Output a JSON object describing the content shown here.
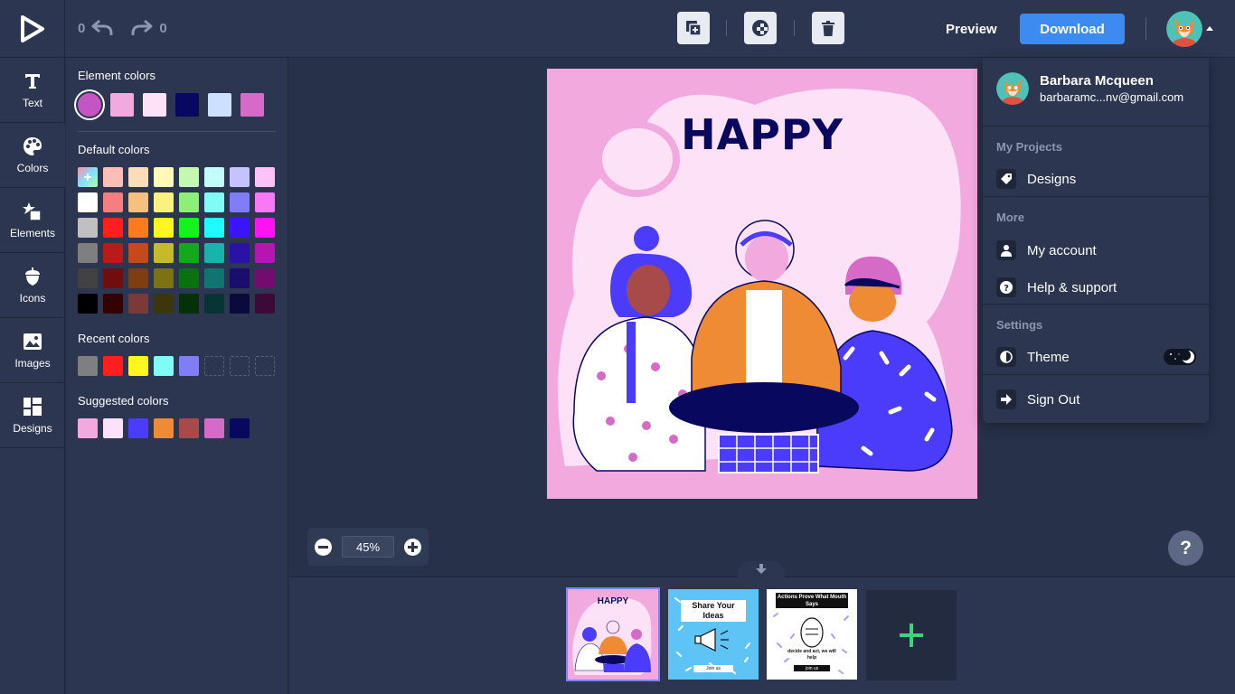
{
  "toolbar": {
    "undo_count": "0",
    "redo_count": "0",
    "preview_label": "Preview",
    "download_label": "Download"
  },
  "rail": {
    "items": [
      {
        "label": "Text",
        "icon": "text-icon"
      },
      {
        "label": "Colors",
        "icon": "palette-icon"
      },
      {
        "label": "Elements",
        "icon": "elements-icon"
      },
      {
        "label": "Icons",
        "icon": "acorn-icon"
      },
      {
        "label": "Images",
        "icon": "image-icon"
      },
      {
        "label": "Designs",
        "icon": "grid-icon"
      }
    ]
  },
  "panel": {
    "element_colors_title": "Element colors",
    "element_colors": [
      "#c356c4",
      "#f2a9de",
      "#fde1f6",
      "#08085e",
      "#cde0ff",
      "#d56bc6"
    ],
    "default_colors_title": "Default colors",
    "default_colors": [
      [
        "add",
        "#ffbdb8",
        "#ffdcb8",
        "#fffab8",
        "#c4f7b0",
        "#c2fffc",
        "#c4c2ff",
        "#ffc2f6"
      ],
      [
        "#ffffff",
        "#f57e7e",
        "#f8c07f",
        "#faf27e",
        "#8cf076",
        "#7ffcf8",
        "#7f7ef7",
        "#f979f5"
      ],
      [
        "#c0c0c0",
        "#ff1f1f",
        "#ff7a1f",
        "#fff51f",
        "#16f21e",
        "#1ffcff",
        "#3a14ff",
        "#ff14f1"
      ],
      [
        "#7f7f7f",
        "#bb1a1a",
        "#c74819",
        "#c7ba28",
        "#12a91d",
        "#17b3ac",
        "#2a11a8",
        "#b714b0"
      ],
      [
        "#424242",
        "#720d0d",
        "#7f3d11",
        "#7b7214",
        "#09720e",
        "#107470",
        "#190d6e",
        "#720c70"
      ],
      [
        "#000000",
        "#330203",
        "#7a3a3a",
        "#3b360b",
        "#053108",
        "#063534",
        "#0b0a3d",
        "#3b0a35"
      ]
    ],
    "recent_colors_title": "Recent colors",
    "recent_colors": [
      "#7f7f7f",
      "#ff1f1f",
      "#fff51f",
      "#7ffcf8",
      "#7f7ef7",
      "",
      "",
      ""
    ],
    "suggested_colors_title": "Suggested colors",
    "suggested_colors": [
      "#f2a9de",
      "#fde1f6",
      "#4a3cfa",
      "#f08b35",
      "#a94a4a",
      "#d56bc6",
      "#08085e"
    ]
  },
  "artboard": {
    "title": "HAPPY",
    "background": "#f2a9de"
  },
  "zoom": {
    "value": "45%"
  },
  "pages": {
    "thumbs": [
      {
        "title": "HAPPY"
      },
      {
        "title": "Share Your Ideas",
        "button": "Join us"
      },
      {
        "title": "Actions Prove What Mouth Says",
        "body": "decide and act, we will help",
        "button": "join us"
      }
    ]
  },
  "menu": {
    "user_name": "Barbara Mcqueen",
    "user_email": "barbaramc...nv@gmail.com",
    "my_projects_header": "My Projects",
    "designs_label": "Designs",
    "more_header": "More",
    "my_account_label": "My account",
    "help_label": "Help & support",
    "settings_header": "Settings",
    "theme_label": "Theme",
    "sign_out_label": "Sign Out"
  },
  "help_label": "?"
}
